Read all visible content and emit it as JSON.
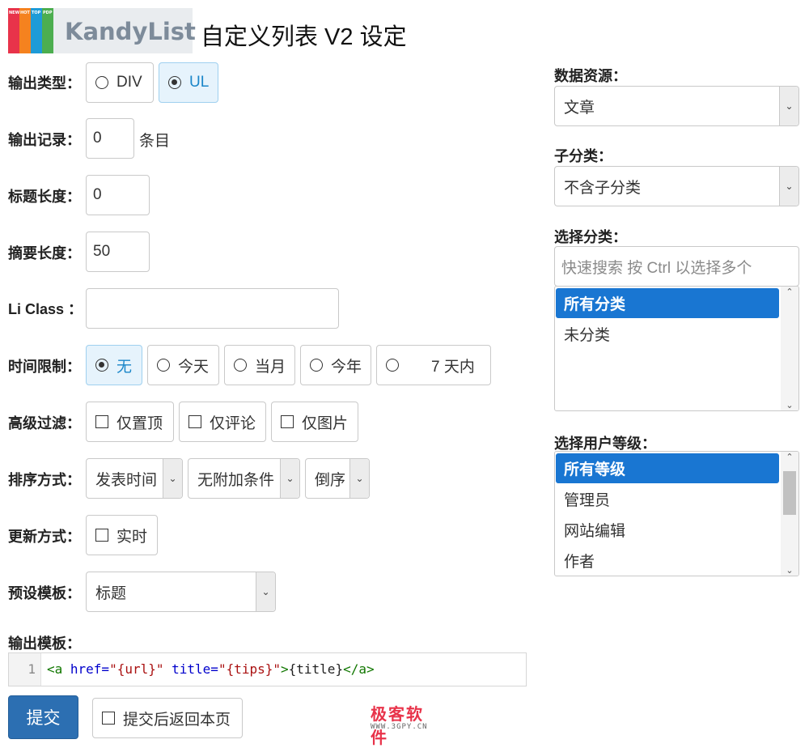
{
  "header": {
    "logo_text": "KandyList",
    "logo_stripes": [
      {
        "text": "NEW",
        "color": "#e8334a"
      },
      {
        "text": "HOT",
        "color": "#f5821f"
      },
      {
        "text": "TOP",
        "color": "#1e9bd7"
      },
      {
        "text": "PDP",
        "color": "#4cae4f"
      }
    ],
    "title": "自定义列表 V2 设定"
  },
  "output_type": {
    "label": "输出类型",
    "colon": "：",
    "options": [
      {
        "label": "DIV",
        "selected": false
      },
      {
        "label": "UL",
        "selected": true
      }
    ]
  },
  "output_count": {
    "label": "输出记录",
    "colon": "：",
    "value": "0",
    "suffix": "条目"
  },
  "title_length": {
    "label": "标题长度",
    "colon": "：",
    "value": "0"
  },
  "summary_length": {
    "label": "摘要长度",
    "colon": "：",
    "value": "50"
  },
  "li_class": {
    "label": "Li Class",
    "colon": "：",
    "value": ""
  },
  "time_limit": {
    "label": "时间限制",
    "colon": "：",
    "options": [
      {
        "label": "无",
        "selected": true
      },
      {
        "label": "今天",
        "selected": false
      },
      {
        "label": "当月",
        "selected": false
      },
      {
        "label": "今年",
        "selected": false
      },
      {
        "label": "7 天内",
        "selected": false
      }
    ]
  },
  "advanced_filter": {
    "label": "高级过滤",
    "colon": "：",
    "options": [
      {
        "label": "仅置顶",
        "checked": false
      },
      {
        "label": "仅评论",
        "checked": false
      },
      {
        "label": "仅图片",
        "checked": false
      }
    ]
  },
  "sort": {
    "label": "排序方式",
    "colon": "：",
    "field": "发表时间",
    "condition": "无附加条件",
    "order": "倒序"
  },
  "update_mode": {
    "label": "更新方式",
    "colon": "：",
    "option": "实时",
    "checked": false
  },
  "preset_template": {
    "label": "预设模板",
    "colon": "：",
    "value": "标题"
  },
  "output_template": {
    "label": "输出模板",
    "colon": "：",
    "line_number": "1",
    "tokens": [
      {
        "t": "<a",
        "c": "c-tag"
      },
      {
        "t": " href=",
        "c": "c-attr"
      },
      {
        "t": "\"{url}\"",
        "c": "c-str"
      },
      {
        "t": " title=",
        "c": "c-attr"
      },
      {
        "t": "\"{tips}\"",
        "c": "c-str"
      },
      {
        "t": ">",
        "c": "c-tag"
      },
      {
        "t": "{title}",
        "c": "c-txt"
      },
      {
        "t": "</a>",
        "c": "c-tag"
      }
    ]
  },
  "actions": {
    "submit": "提交",
    "return_label": "提交后返回本页",
    "return_checked": false
  },
  "data_source": {
    "label": "数据资源",
    "colon": "：",
    "value": "文章"
  },
  "subcategory": {
    "label": "子分类",
    "colon": "：",
    "value": "不含子分类"
  },
  "category": {
    "label": "选择分类",
    "colon": "：",
    "search_placeholder": "快速搜索 按 Ctrl 以选择多个",
    "items": [
      {
        "label": "所有分类",
        "selected": true
      },
      {
        "label": "未分类",
        "selected": false
      }
    ]
  },
  "user_level": {
    "label": "选择用户等级",
    "colon": "：",
    "items": [
      {
        "label": "所有等级",
        "selected": true
      },
      {
        "label": "管理员",
        "selected": false
      },
      {
        "label": "网站编辑",
        "selected": false
      },
      {
        "label": "作者",
        "selected": false
      }
    ]
  },
  "watermark": {
    "glyphs": "极客软件",
    "url": "WWW.3GPY.CN"
  },
  "colors": {
    "accent": "#1976d2",
    "submit": "#2c6fb2",
    "radio_active_bg": "#e6f3fc"
  }
}
